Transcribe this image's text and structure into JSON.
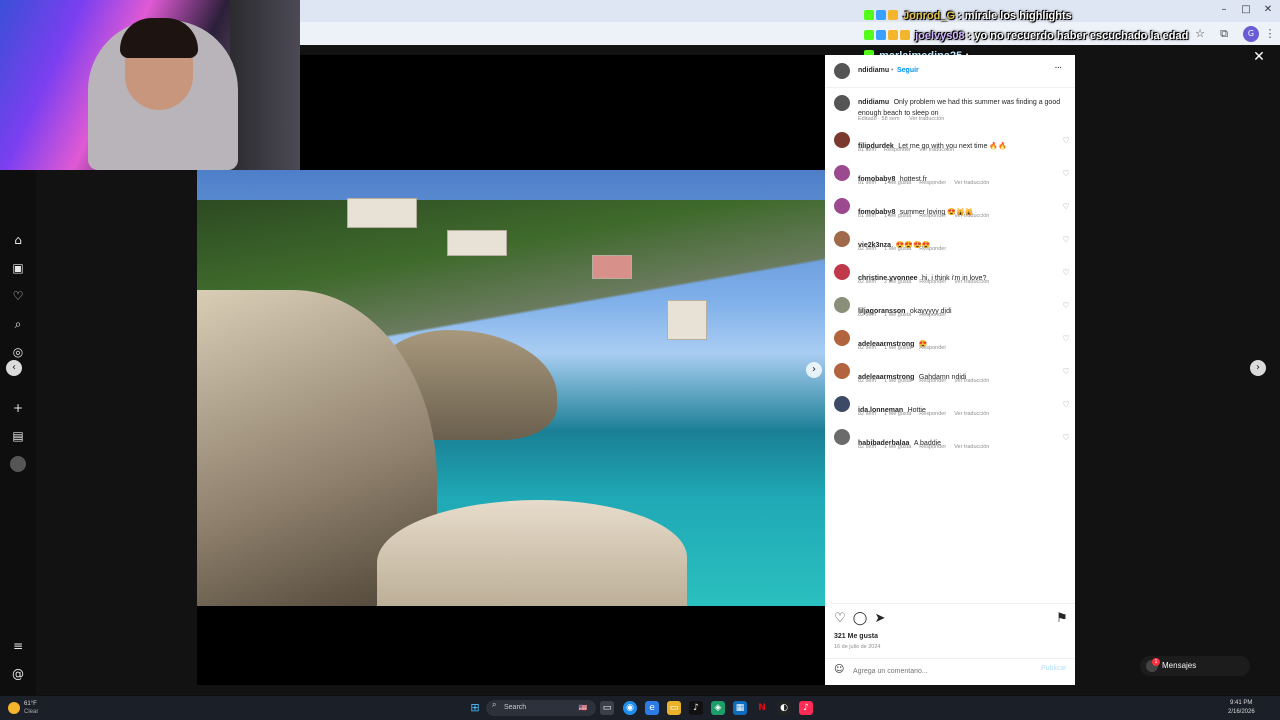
{
  "stream_chat": [
    {
      "user": "Jonrod_G",
      "message": "mírale los highlights"
    },
    {
      "user": "joelvys08",
      "message": "yo no recuerdo haber escuchado la edad"
    },
    {
      "user": "marlajmedina25",
      "message": ""
    }
  ],
  "browser": {
    "window_controls": [
      "–",
      "□",
      "✕"
    ]
  },
  "post": {
    "author": "ndidiamu",
    "follow_label": "Seguir",
    "more_label": "···",
    "caption": {
      "user": "ndidiamu",
      "text": "Only problem we had this summer was finding a good enough beach to sleep on",
      "meta": [
        "Editado · 58 sem",
        "Ver traducción"
      ]
    },
    "comments": [
      {
        "user": "filipdurdek",
        "text": "Let me go with you next time 🔥🔥",
        "meta": [
          "81 sem",
          "Responder",
          "Ver traducción"
        ],
        "avatar_color": "#7a3b2e"
      },
      {
        "user": "fomobaby8",
        "text": "hottest fr",
        "meta": [
          "81 sem",
          "1 Me gusta",
          "Responder",
          "Ver traducción"
        ],
        "avatar_color": "#9b4a8f"
      },
      {
        "user": "fomobaby8",
        "text": "summer loving 😍🙀🙀",
        "meta": [
          "81 sem",
          "1 Me gusta",
          "Responder",
          "Ver traducción"
        ],
        "avatar_color": "#9b4a8f"
      },
      {
        "user": "vie2k3nza",
        "text": "😍😍😍😍",
        "meta": [
          "82 sem",
          "1 Me gusta",
          "Responder"
        ],
        "avatar_color": "#a06a4a"
      },
      {
        "user": "christine.yvonnee",
        "text": "hi, i think i'm in love?",
        "meta": [
          "82 sem",
          "2 Me gusta",
          "Responder",
          "Ver traducción"
        ],
        "avatar_color": "#c0394a"
      },
      {
        "user": "liljagoransson",
        "text": "okayyyyy didi",
        "meta": [
          "82 sem",
          "1 Me gusta",
          "Responder"
        ],
        "avatar_color": "#8a8f7a"
      },
      {
        "user": "adeleaarmstrong",
        "text": "😍",
        "meta": [
          "82 sem",
          "1 Me gusta",
          "Responder"
        ],
        "avatar_color": "#b2643f"
      },
      {
        "user": "adeleaarmstrong",
        "text": "Gahdamn ndidi",
        "meta": [
          "82 sem",
          "1 Me gusta",
          "Responder",
          "Ver traducción"
        ],
        "avatar_color": "#b2643f"
      },
      {
        "user": "ida.lonneman",
        "text": "Hottie",
        "meta": [
          "82 sem",
          "1 Me gusta",
          "Responder",
          "Ver traducción"
        ],
        "avatar_color": "#3d4a66"
      },
      {
        "user": "habibaderbalaa",
        "text": "A baddie",
        "meta": [
          "82 sem",
          "1 Me gusta",
          "Responder",
          "Ver traducción"
        ],
        "avatar_color": "#6b6b6b"
      }
    ],
    "likes": "321 Me gusta",
    "date": "16 de julio de 2024",
    "comment_placeholder": "Agrega un comentario...",
    "publish_label": "Publicar"
  },
  "messages_pill": {
    "label": "Mensajes",
    "count": "1"
  },
  "taskbar": {
    "weather_temp": "61°F",
    "weather_desc": "Clear",
    "search_placeholder": "Search",
    "time": "9:41 PM",
    "date": "2/16/2026"
  },
  "icons": {
    "nav": [
      "home-icon",
      "reels-icon",
      "notifications-icon",
      "search-icon",
      "explore-icon",
      "create-icon",
      "dashboard-icon",
      "profile-icon",
      "menu-icon",
      "threads-icon"
    ],
    "actions": [
      "like-icon",
      "comment-icon",
      "share-icon",
      "save-icon"
    ]
  }
}
